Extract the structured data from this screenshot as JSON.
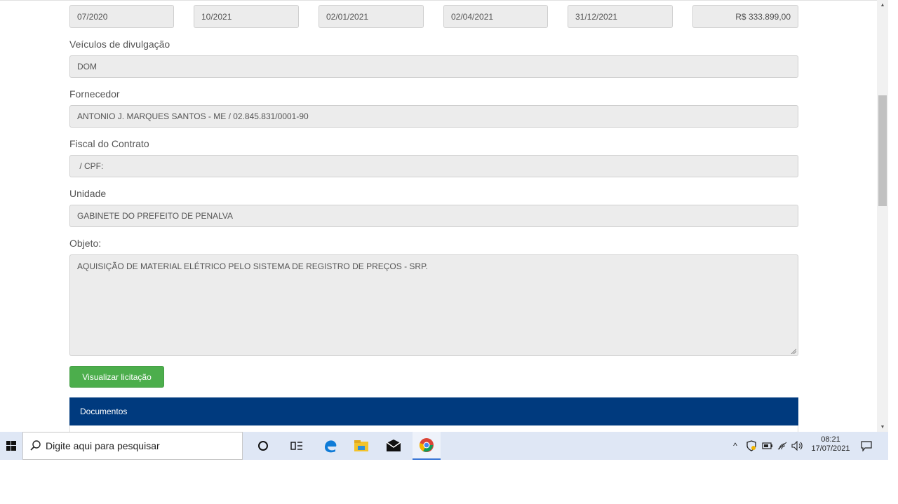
{
  "top_row": [
    "07/2020",
    "10/2021",
    "02/01/2021",
    "02/04/2021",
    "31/12/2021",
    "R$ 333.899,00"
  ],
  "veiculos": {
    "label": "Veículos de divulgação",
    "value": "DOM"
  },
  "fornecedor": {
    "label": "Fornecedor",
    "value": "ANTONIO J. MARQUES SANTOS - ME / 02.845.831/0001-90"
  },
  "fiscal": {
    "label": "Fiscal do Contrato",
    "value": " / CPF:"
  },
  "unidade": {
    "label": "Unidade",
    "value": "GABINETE DO PREFEITO DE PENALVA"
  },
  "objeto": {
    "label": "Objeto:",
    "value": "AQUISIÇÃO DE MATERIAL ELÉTRICO PELO SISTEMA DE REGISTRO DE PREÇOS - SRP."
  },
  "button_label": "Visualizar licitação",
  "panel_title": "Documentos",
  "taskbar": {
    "search_placeholder": "Digite aqui para pesquisar",
    "time": "08:21",
    "date": "17/07/2021",
    "pinned": [
      "cortana-icon",
      "task-view-icon",
      "edge-icon",
      "file-explorer-icon",
      "mail-icon",
      "chrome-icon"
    ]
  },
  "colors": {
    "panel_header": "#003a7e",
    "button": "#4cae4c",
    "taskbar": "#dfe7f5"
  }
}
